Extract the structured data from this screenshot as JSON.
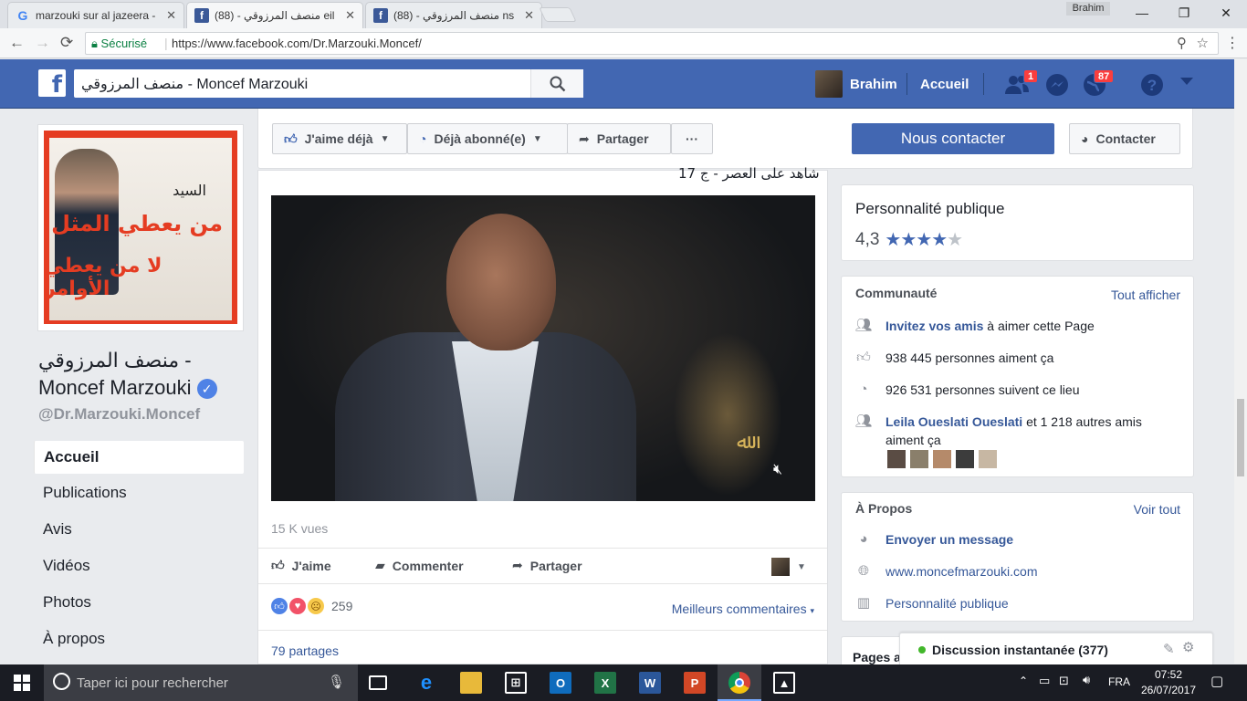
{
  "browser": {
    "tabs": [
      {
        "title": "marzouki sur al jazeera -",
        "icon": "google-icon",
        "active": false
      },
      {
        "title": "منصف المرزوقي - (88) eil",
        "icon": "facebook-icon",
        "active": true
      },
      {
        "title": "منصف المرزوقي - (88) ns",
        "icon": "facebook-icon",
        "active": false
      }
    ],
    "profile_name": "Brahim",
    "secure_label": "Sécurisé",
    "url": "https://www.facebook.com/Dr.Marzouki.Moncef/"
  },
  "fb_header": {
    "search_value": "منصف المرزوقي - Moncef Marzouki",
    "user_name": "Brahim",
    "home_label": "Accueil",
    "friend_requests_count": "1",
    "notifications_count": "87"
  },
  "left_column": {
    "poster_text": {
      "line1": "السيد",
      "line2": "من يعطي المثل",
      "line3": "لا من يعطي الأوامر"
    },
    "page_name_ar": "منصف المرزوقي -",
    "page_name_fr": "Moncef Marzouki",
    "handle": "@Dr.Marzouki.Moncef",
    "nav": [
      {
        "label": "Accueil",
        "selected": true
      },
      {
        "label": "Publications"
      },
      {
        "label": "Avis"
      },
      {
        "label": "Vidéos"
      },
      {
        "label": "Photos"
      },
      {
        "label": "À propos"
      }
    ]
  },
  "action_bar": {
    "like_label": "J'aime déjà",
    "follow_label": "Déjà abonné(e)",
    "share_label": "Partager",
    "more_label": "···",
    "contact_primary": "Nous contacter",
    "contact_secondary": "Contacter"
  },
  "post": {
    "title_fragment": "شاهد على العصر - ج 17",
    "views": "15 K vues",
    "like_label": "J'aime",
    "comment_label": "Commenter",
    "share_label": "Partager",
    "reaction_count": "259",
    "best_comments": "Meilleurs commentaires",
    "shares": "79 partages"
  },
  "right_column": {
    "category": "Personnalité publique",
    "rating": "4,3",
    "stars_value": 4.3,
    "community": {
      "title": "Communauté",
      "see_all": "Tout afficher",
      "invite_link": "Invitez vos amis",
      "invite_rest": "à aimer cette Page",
      "likes": "938 445 personnes aiment ça",
      "follows": "926 531 personnes suivent ce lieu",
      "friends_link": "Leila Oueslati Oueslati",
      "friends_rest": "et 1 218 autres amis aiment ça"
    },
    "about": {
      "title": "À Propos",
      "see_all": "Voir tout",
      "message": "Envoyer un message",
      "website": "www.moncefmarzouki.com",
      "category": "Personnalité publique"
    },
    "pages_partial": "Pages a"
  },
  "chat": {
    "label": "Discussion instantanée (377)"
  },
  "taskbar": {
    "search_placeholder": "Taper ici pour rechercher",
    "lang": "FRA",
    "time": "07:52",
    "date": "26/07/2017"
  },
  "colors": {
    "fb_blue": "#4267b2",
    "link": "#365899",
    "badge": "#fa3e3e"
  }
}
